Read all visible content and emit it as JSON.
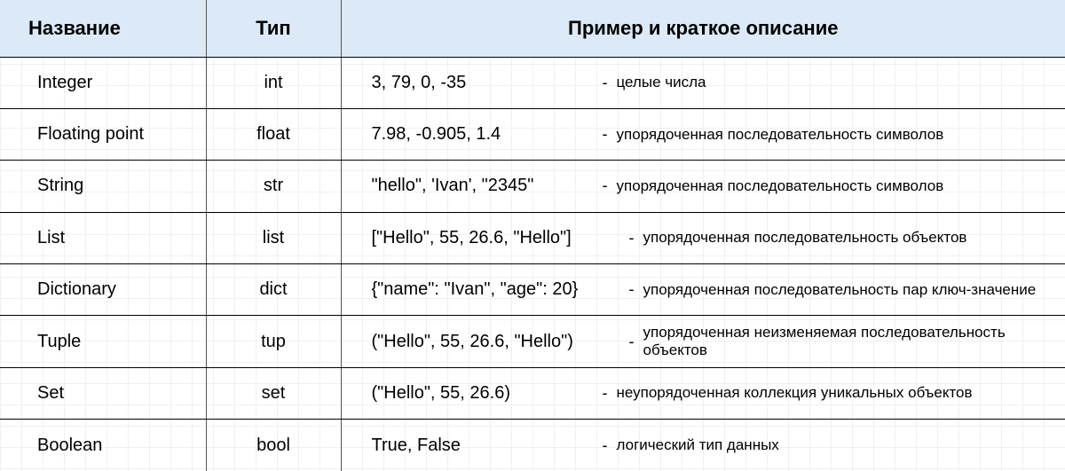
{
  "headers": {
    "name": "Название",
    "type": "Тип",
    "desc": "Пример и краткое описание"
  },
  "rows": [
    {
      "name": "Integer",
      "type": "int",
      "example": "3, 79, 0, -35",
      "dash": "-",
      "explain": "целые числа",
      "wide": false
    },
    {
      "name": "Floating point",
      "type": "float",
      "example": "7.98, -0.905, 1.4",
      "dash": "-",
      "explain": "упорядоченная последовательность символов",
      "wide": false
    },
    {
      "name": "String",
      "type": "str",
      "example": "\"hello\", 'Ivan', \"2345\"",
      "dash": "-",
      "explain": "упорядоченная последовательность символов",
      "wide": false
    },
    {
      "name": "List",
      "type": "list",
      "example": "[\"Hello\", 55, 26.6, \"Hello\"]",
      "dash": "-",
      "explain": "упорядоченная последовательность объектов",
      "wide": true
    },
    {
      "name": "Dictionary",
      "type": "dict",
      "example": "{\"name\": \"Ivan\", \"age\": 20}",
      "dash": "-",
      "explain": "упорядоченная последовательность пар ключ-значение",
      "wide": true
    },
    {
      "name": "Tuple",
      "type": "tup",
      "example": "(\"Hello\", 55, 26.6, \"Hello\")",
      "dash": "-",
      "explain": "упорядоченная неизменяемая последовательность объектов",
      "wide": true
    },
    {
      "name": "Set",
      "type": "set",
      "example": "(\"Hello\", 55, 26.6)",
      "dash": "-",
      "explain": "неупорядоченная коллекция уникальных объектов",
      "wide": false
    },
    {
      "name": "Boolean",
      "type": "bool",
      "example": "True, False",
      "dash": "-",
      "explain": "логический тип данных",
      "wide": false
    }
  ]
}
